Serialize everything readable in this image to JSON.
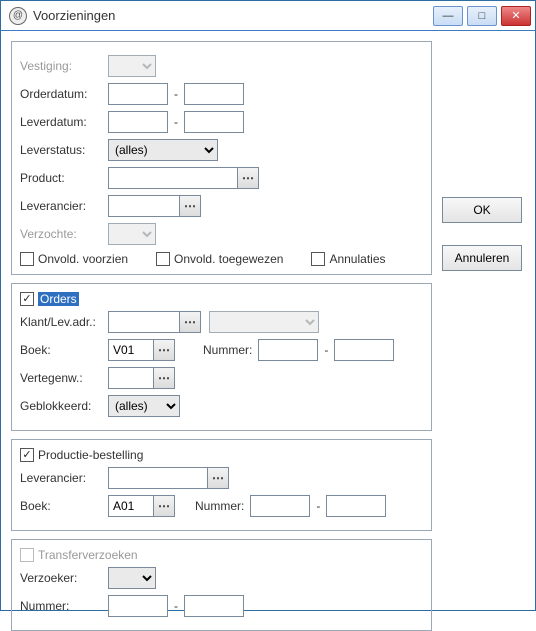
{
  "window": {
    "title": "Voorzieningen"
  },
  "buttons": {
    "ok": "OK",
    "cancel": "Annuleren"
  },
  "icons": {
    "app": "@",
    "min": "—",
    "max": "□",
    "close": "✕",
    "pick": "⋯"
  },
  "filters": {
    "vestiging_label": "Vestiging:",
    "orderdatum_label": "Orderdatum:",
    "leverdatum_label": "Leverdatum:",
    "leverstatus_label": "Leverstatus:",
    "leverstatus_value": "(alles)",
    "product_label": "Product:",
    "leverancier_label": "Leverancier:",
    "verzochte_label": "Verzochte:",
    "onvold_voorzien": "Onvold. voorzien",
    "onvold_toegewezen": "Onvold. toegewezen",
    "annulaties": "Annulaties",
    "orderdatum_from": "",
    "orderdatum_to": "",
    "leverdatum_from": "",
    "leverdatum_to": "",
    "product": "",
    "leverancier": "",
    "chk_onvold_voorzien": false,
    "chk_onvold_toegewezen": false,
    "chk_annulaties": false
  },
  "orders": {
    "title": "Orders",
    "checked": true,
    "klantlevadr_label": "Klant/Lev.adr.:",
    "klantlevadr": "",
    "boek_label": "Boek:",
    "boek": "V01",
    "nummer_label": "Nummer:",
    "nummer_from": "",
    "nummer_to": "",
    "vertegenw_label": "Vertegenw.:",
    "vertegenw": "",
    "geblokkeerd_label": "Geblokkeerd:",
    "geblokkeerd_value": "(alles)"
  },
  "productie": {
    "title": "Productie-bestelling",
    "checked": true,
    "leverancier_label": "Leverancier:",
    "leverancier": "",
    "boek_label": "Boek:",
    "boek": "A01",
    "nummer_label": "Nummer:",
    "nummer_from": "",
    "nummer_to": ""
  },
  "transfer": {
    "title": "Transferverzoeken",
    "checked": false,
    "verzoeker_label": "Verzoeker:",
    "nummer_label": "Nummer:",
    "nummer_from": "",
    "nummer_to": ""
  }
}
